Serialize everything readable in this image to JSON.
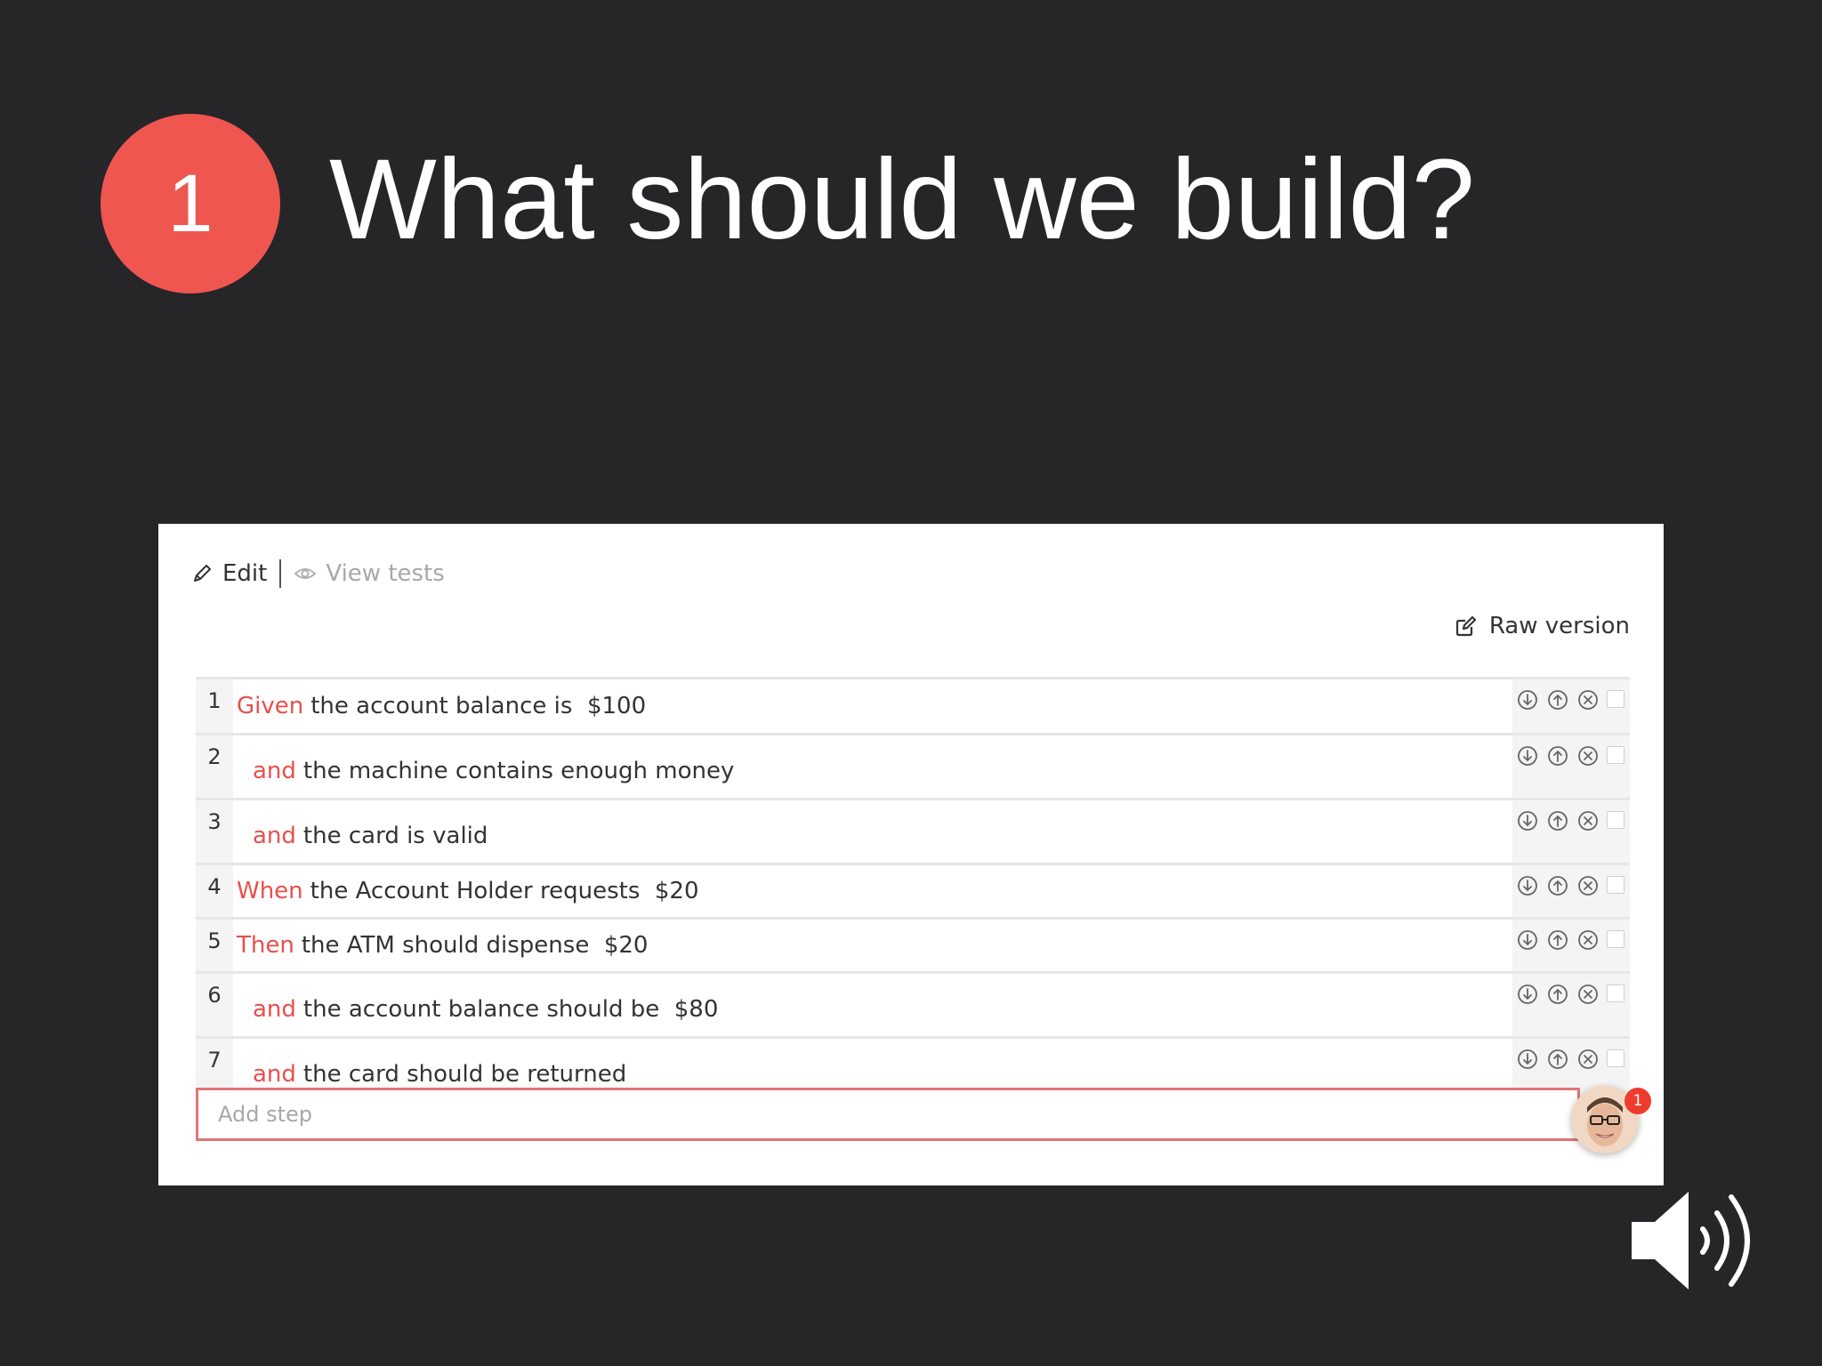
{
  "slide": {
    "step_number": "1",
    "title": "What should we build?"
  },
  "toolbar": {
    "edit_label": "Edit",
    "view_tests_label": "View tests"
  },
  "raw_version_label": "Raw version",
  "steps": [
    {
      "number": "1",
      "keyword": "Given",
      "text": "the account balance is  $100",
      "indent": false
    },
    {
      "number": "2",
      "keyword": "and",
      "text": "the machine contains enough money",
      "indent": true
    },
    {
      "number": "3",
      "keyword": "and",
      "text": "the card is valid",
      "indent": true
    },
    {
      "number": "4",
      "keyword": "When",
      "text": "the Account Holder requests  $20",
      "indent": false
    },
    {
      "number": "5",
      "keyword": "Then",
      "text": "the ATM should dispense  $20",
      "indent": false
    },
    {
      "number": "6",
      "keyword": "and",
      "text": "the account balance should be  $80",
      "indent": true
    },
    {
      "number": "7",
      "keyword": "and",
      "text": "the card should be returned",
      "indent": true
    }
  ],
  "row_actions": [
    "move-down-icon",
    "move-up-icon",
    "delete-icon"
  ],
  "add_step": {
    "placeholder": "Add step",
    "value": ""
  },
  "notification_count": "1",
  "colors": {
    "background": "#262528",
    "accent": "#ef5650",
    "keyword": "#e94f4b",
    "add_step_border": "#e27474"
  }
}
